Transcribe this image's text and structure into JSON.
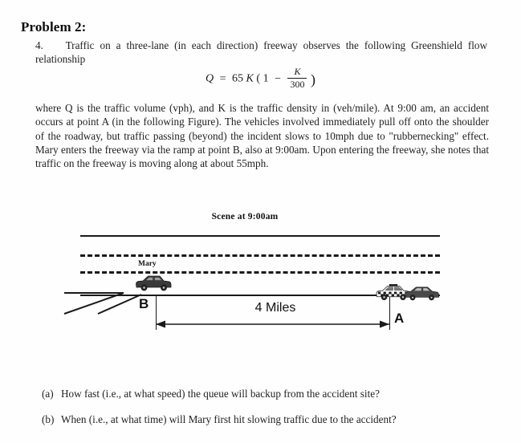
{
  "heading": "Problem 2:",
  "problem": {
    "number": "4.",
    "intro": "Traffic on a three-lane (in each direction) freeway observes the following Greenshield flow relationship",
    "equation": {
      "lhs": "Q",
      "equals": "=",
      "coefficient": "65",
      "variable": "K",
      "open_paren": "(",
      "one": "1",
      "minus": "−",
      "numerator": "K",
      "denominator": "300",
      "close_paren": ")",
      "plain": "Q = 65K(1 - K/300)"
    },
    "body": "where Q is the traffic volume (vph), and K is the traffic density in (veh/mile). At 9:00 am, an accident occurs at point A (in the following Figure). The vehicles involved immediately pull off onto the shoulder of the roadway, but traffic passing (beyond) the incident slows to 10mph due to \"rubbernecking\" effect. Mary enters the freeway via the ramp at point B, also at 9:00am. Upon entering the freeway, she notes that traffic on the freeway is moving along at about 55mph."
  },
  "figure": {
    "title": "Scene at 9:00am",
    "mary_label": "Mary",
    "point_b_label": "B",
    "point_a_label": "A",
    "distance_label": "4 Miles",
    "icons": {
      "mary_car": "car-icon",
      "police_car": "police-car-icon",
      "accident_car": "car-icon",
      "ramp": "on-ramp-icon",
      "dimension_arrow": "double-arrow-icon"
    }
  },
  "questions": [
    {
      "tag": "(a)",
      "text": "How fast (i.e., at what speed) the queue will backup from the accident site?"
    },
    {
      "tag": "(b)",
      "text": "When (i.e., at what time) will Mary first hit slowing traffic due to the accident?"
    }
  ],
  "colors": {
    "ink": "#1a1a1a",
    "page": "#fefefe"
  }
}
